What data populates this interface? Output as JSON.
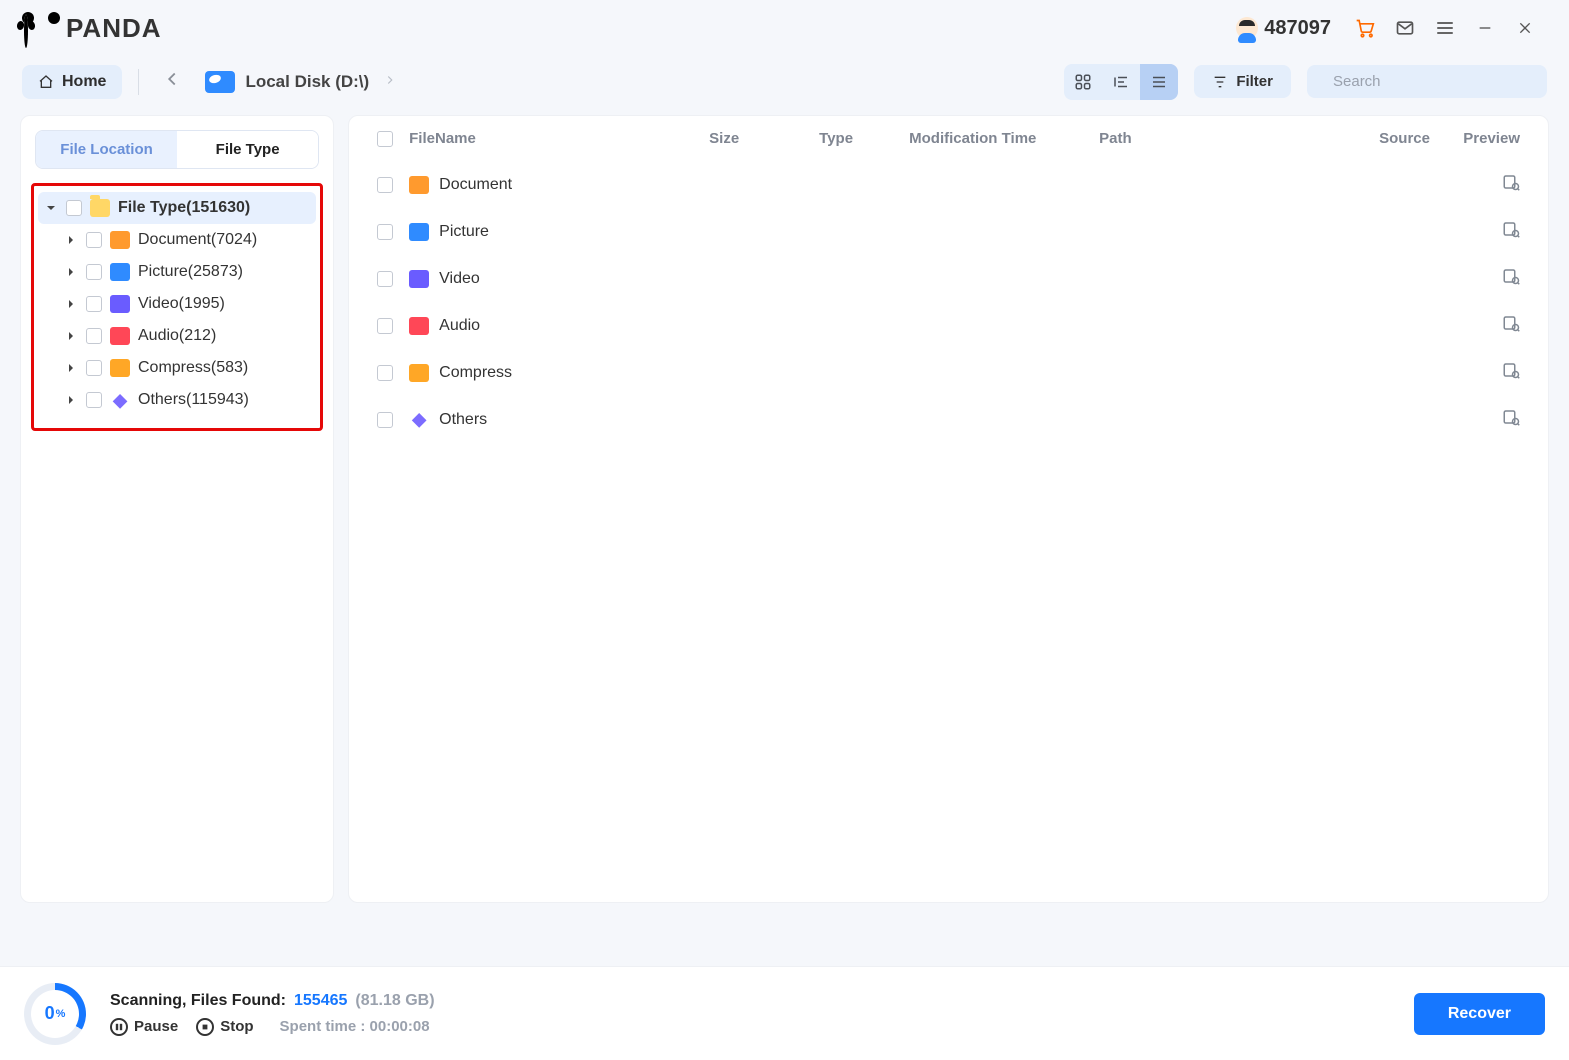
{
  "app": {
    "brand": "PANDA"
  },
  "titlebar": {
    "account_count": "487097"
  },
  "toolbar": {
    "home_label": "Home",
    "breadcrumb_disk": "Local Disk (D:\\)",
    "filter_label": "Filter",
    "search_placeholder": "Search"
  },
  "sidebar": {
    "tabs": {
      "location": "File Location",
      "type": "File Type"
    },
    "root": {
      "label": "File Type",
      "count": "151630"
    },
    "items": [
      {
        "label": "Document",
        "count": "7024",
        "icon": "doc"
      },
      {
        "label": "Picture",
        "count": "25873",
        "icon": "pic"
      },
      {
        "label": "Video",
        "count": "1995",
        "icon": "vid"
      },
      {
        "label": "Audio",
        "count": "212",
        "icon": "aud"
      },
      {
        "label": "Compress",
        "count": "583",
        "icon": "cmp"
      },
      {
        "label": "Others",
        "count": "115943",
        "icon": "oth"
      }
    ]
  },
  "table": {
    "headers": {
      "filename": "FileName",
      "size": "Size",
      "type": "Type",
      "mtime": "Modification Time",
      "path": "Path",
      "source": "Source",
      "preview": "Preview"
    },
    "rows": [
      {
        "name": "Document",
        "icon": "doc"
      },
      {
        "name": "Picture",
        "icon": "pic"
      },
      {
        "name": "Video",
        "icon": "vid"
      },
      {
        "name": "Audio",
        "icon": "aud"
      },
      {
        "name": "Compress",
        "icon": "cmp"
      },
      {
        "name": "Others",
        "icon": "oth"
      }
    ]
  },
  "footer": {
    "progress_label": "0",
    "progress_unit": "%",
    "status_label": "Scanning, Files Found:",
    "files_found": "155465",
    "total_size": "(81.18 GB)",
    "pause_label": "Pause",
    "stop_label": "Stop",
    "spent_label": "Spent time : 00:00:08",
    "recover_label": "Recover"
  }
}
